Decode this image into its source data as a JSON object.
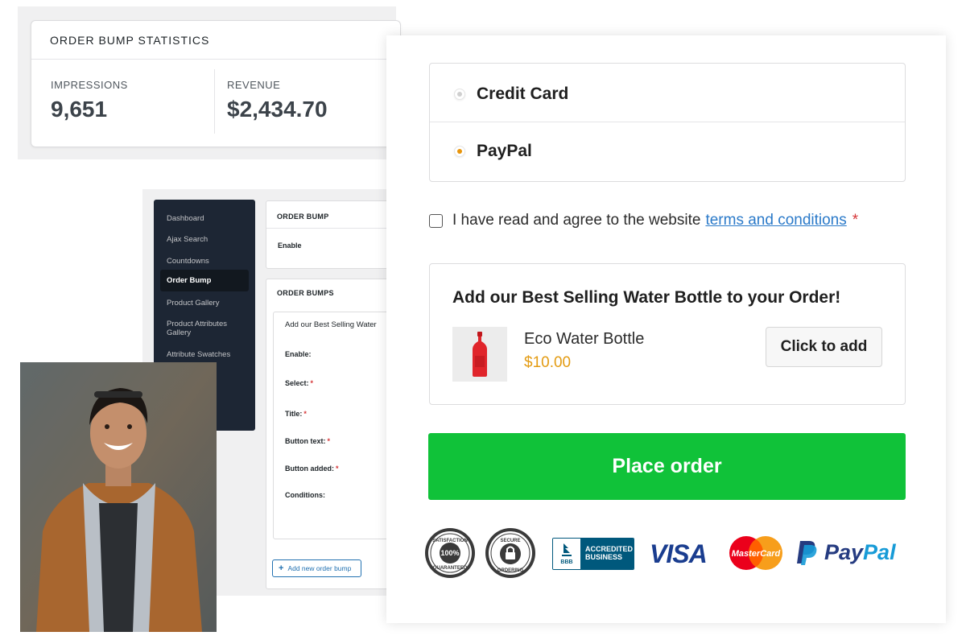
{
  "stats": {
    "title": "ORDER BUMP STATISTICS",
    "impressions_label": "IMPRESSIONS",
    "impressions_value": "9,651",
    "revenue_label": "REVENUE",
    "revenue_value": "$2,434.70"
  },
  "admin": {
    "sidebar": [
      {
        "label": "Dashboard"
      },
      {
        "label": "Ajax Search"
      },
      {
        "label": "Countdowns"
      },
      {
        "label": "Order Bump",
        "active": true
      },
      {
        "label": "Product Gallery"
      },
      {
        "label": "Product Attributes Gallery"
      },
      {
        "label": "Attribute Swatches"
      }
    ],
    "order_bump_heading": "ORDER BUMP",
    "enable_label": "Enable",
    "order_bumps_heading": "ORDER BUMPS",
    "bump_item_title": "Add our Best Selling Water",
    "fields": [
      {
        "label": "Enable:",
        "required": false
      },
      {
        "label": "Select:",
        "required": true
      },
      {
        "label": "Title:",
        "required": true
      },
      {
        "label": "Button text:",
        "required": true
      },
      {
        "label": "Button added:",
        "required": true
      },
      {
        "label": "Conditions:",
        "required": false
      }
    ],
    "required_mark": "*",
    "add_new_label": "Add new order bump"
  },
  "checkout": {
    "payment_methods": [
      {
        "label": "Credit Card",
        "selected": false
      },
      {
        "label": "PayPal",
        "selected": true
      }
    ],
    "terms_text": "I have read and agree to the website",
    "terms_link": "terms and conditions",
    "required_mark": "*",
    "bump_title": "Add our Best Selling Water Bottle to your Order!",
    "product_name": "Eco Water Bottle",
    "product_price": "$10.00",
    "add_button": "Click to add",
    "place_order": "Place order"
  },
  "trust_badges": {
    "satisfaction_top": "SATISFACTION",
    "satisfaction_center": "100%",
    "satisfaction_bottom": "GUARANTEED",
    "secure_top": "SECURE",
    "secure_bottom": "ORDERING",
    "bbb_mark": "BBB",
    "bbb_line1": "ACCREDITED",
    "bbb_line2": "BUSINESS",
    "visa": "VISA",
    "mastercard": "MasterCard",
    "paypal_pay": "Pay",
    "paypal_pal": "Pal"
  },
  "colors": {
    "place_order_green": "#10c239",
    "price_orange": "#e39b12",
    "radio_selected": "#e8950c",
    "link_blue": "#2b7ac9",
    "sidebar_dark": "#1d2634"
  }
}
